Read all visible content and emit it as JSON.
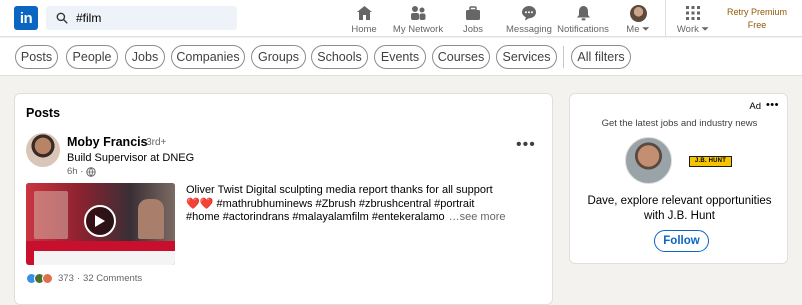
{
  "topnav": {
    "logo": "in",
    "search": {
      "value": "#film"
    },
    "items": [
      {
        "label": "Home",
        "icon": "home-icon"
      },
      {
        "label": "My Network",
        "icon": "network-icon"
      },
      {
        "label": "Jobs",
        "icon": "jobs-icon"
      },
      {
        "label": "Messaging",
        "icon": "messaging-icon"
      },
      {
        "label": "Notifications",
        "icon": "notifications-icon"
      },
      {
        "label": "Me ⏷",
        "icon": "avatar"
      },
      {
        "label": "Work ⏷",
        "icon": "grid-icon"
      }
    ],
    "premium": {
      "line1": "Retry Premium",
      "line2": "Free"
    }
  },
  "filters": {
    "pills": [
      "Posts",
      "People",
      "Jobs",
      "Companies",
      "Groups",
      "Schools",
      "Events",
      "Courses",
      "Services"
    ],
    "all_filters": "All filters"
  },
  "posts": {
    "heading": "Posts",
    "post": {
      "author": "Moby Francis",
      "degree": "· 3rd+",
      "title": "Build Supervisor at DNEG",
      "time": "6h ·",
      "line1": "Oliver Twist Digital sculpting media report thanks for all support",
      "line2": "❤️❤️ #mathrubhuminews #Zbrush #zbrushcentral #portrait",
      "line3": "#home #actorindrans #malayalamfilm #entekeralamo",
      "see_more": "…see more",
      "reaction_count": "373",
      "separator": "·",
      "comments": "32 Comments"
    }
  },
  "ad": {
    "label": "Ad",
    "tagline": "Get the latest jobs and industry news",
    "company_logo_text": "J.B. HUNT",
    "text": "Dave, explore relevant opportunities with J.B. Hunt",
    "follow": "Follow"
  },
  "colors": {
    "brand": "#0a66c2",
    "premium": "#915907",
    "background": "#f3f2ef"
  }
}
